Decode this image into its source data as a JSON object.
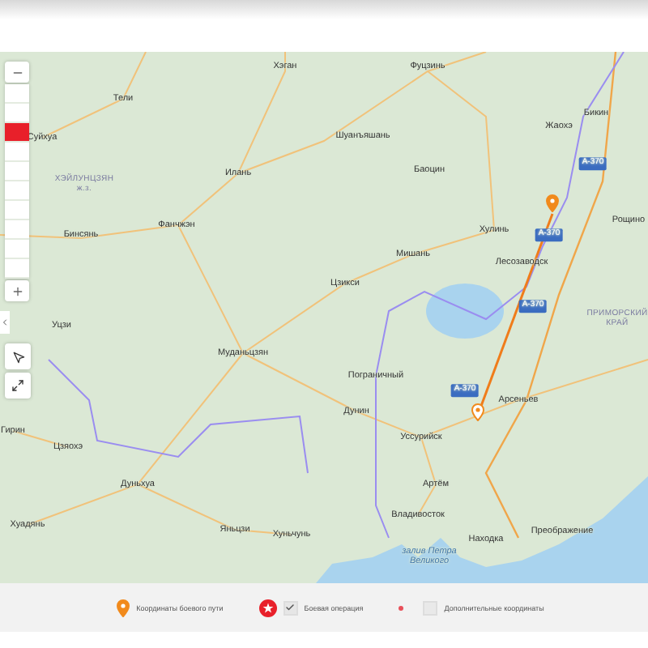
{
  "map": {
    "labels": [
      {
        "kind": "city",
        "text": "Хэган"
      },
      {
        "kind": "city",
        "text": "Фуцзинь"
      },
      {
        "kind": "city",
        "text": "Тели"
      },
      {
        "kind": "city",
        "text": "Суйхуа"
      },
      {
        "kind": "city",
        "text": "Шуанъяшань"
      },
      {
        "kind": "city",
        "text": "Жаохэ"
      },
      {
        "kind": "city",
        "text": "Бикин"
      },
      {
        "kind": "city",
        "text": "Илань"
      },
      {
        "kind": "city",
        "text": "Баоцин"
      },
      {
        "kind": "road",
        "text": "А-370"
      },
      {
        "kind": "region",
        "text": "ХЭЙЛУНЦЗЯН\nж.з."
      },
      {
        "kind": "city",
        "text": "Рощино"
      },
      {
        "kind": "city",
        "text": "Фанчжэн"
      },
      {
        "kind": "city",
        "text": "Бинсянь"
      },
      {
        "kind": "city",
        "text": "Хулинь"
      },
      {
        "kind": "road",
        "text": "А-370"
      },
      {
        "kind": "city",
        "text": "Мишань"
      },
      {
        "kind": "city",
        "text": "Лесозаводск"
      },
      {
        "kind": "city",
        "text": "Цзикси"
      },
      {
        "kind": "road",
        "text": "А-370"
      },
      {
        "kind": "region",
        "text": "ПРИМОРСКИЙ\nКРАЙ"
      },
      {
        "kind": "city",
        "text": "Уцзи"
      },
      {
        "kind": "city",
        "text": "Муданьцзян"
      },
      {
        "kind": "city",
        "text": "Пограничный"
      },
      {
        "kind": "road",
        "text": "А-370"
      },
      {
        "kind": "city",
        "text": "Арсеньев"
      },
      {
        "kind": "city",
        "text": "Дунин"
      },
      {
        "kind": "city",
        "text": "Уссурийск"
      },
      {
        "kind": "city",
        "text": "Гирин"
      },
      {
        "kind": "city",
        "text": "Цзяохэ"
      },
      {
        "kind": "city",
        "text": "Дуньхуа"
      },
      {
        "kind": "city",
        "text": "Артём"
      },
      {
        "kind": "city",
        "text": "Владивосток"
      },
      {
        "kind": "city",
        "text": "Находка"
      },
      {
        "kind": "city",
        "text": "Преображение"
      },
      {
        "kind": "city",
        "text": "Хуадянь"
      },
      {
        "kind": "city",
        "text": "Яньцзи"
      },
      {
        "kind": "city",
        "text": "Хуньчунь"
      },
      {
        "kind": "water",
        "text": "залив Петра\nВеликого"
      }
    ],
    "zoom": {
      "level": 0.78
    }
  },
  "legend": [
    {
      "kind": "route-pin",
      "label": "Координаты боевого пути"
    },
    {
      "kind": "battle",
      "label": "Боевая операция",
      "checked": true
    },
    {
      "kind": "extra",
      "label": "Дополнительные координаты",
      "checked": false
    }
  ]
}
